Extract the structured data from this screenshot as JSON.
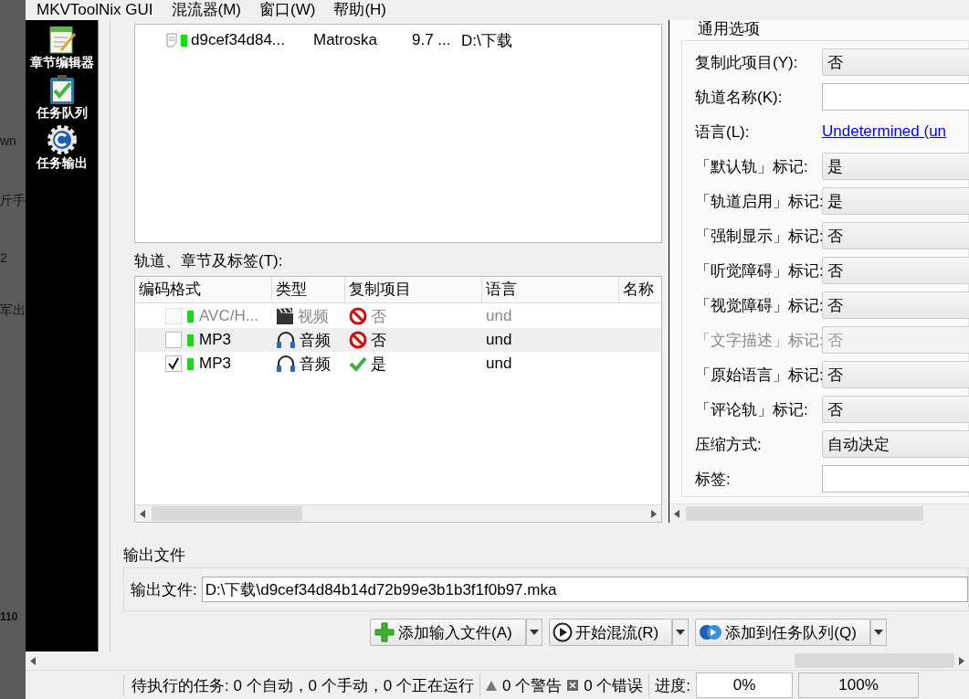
{
  "background_window": {
    "texts": [
      "wn",
      "斤手",
      "2",
      "军出",
      "110"
    ]
  },
  "menu_bar": {
    "title": "MKVToolNix GUI",
    "items": [
      {
        "label": "混流器(M)"
      },
      {
        "label": "窗口(W)"
      },
      {
        "label": "帮助(H)"
      }
    ]
  },
  "sidebar": {
    "items": [
      {
        "label": "章节编辑器",
        "kind": "notepad"
      },
      {
        "label": "任务队列",
        "kind": "clipboard"
      },
      {
        "label": "任务输出",
        "kind": "gear"
      }
    ]
  },
  "source_files": {
    "rows": [
      {
        "name": "d9cef34d84...",
        "format": "Matroska",
        "size": "9.7 ...",
        "path": "D:\\下载"
      }
    ]
  },
  "tracks": {
    "label": "轨道、章节及标签(T):",
    "columns": [
      "编码格式",
      "类型",
      "复制项目",
      "语言",
      "名称"
    ],
    "rows": [
      {
        "checked": false,
        "disabled": true,
        "codec": "AVC/H...",
        "kind": "video",
        "type": "视频",
        "copy": false,
        "copy_label": "否",
        "language": "und"
      },
      {
        "checked": false,
        "disabled": false,
        "codec": "MP3",
        "kind": "audio",
        "type": "音频",
        "copy": false,
        "copy_label": "否",
        "language": "und"
      },
      {
        "checked": true,
        "disabled": false,
        "codec": "MP3",
        "kind": "audio",
        "type": "音频",
        "copy": true,
        "copy_label": "是",
        "language": "und"
      }
    ]
  },
  "properties": {
    "section": "通用选项",
    "fields": [
      {
        "label": "复制此项目(Y):",
        "kind": "select",
        "value": "否",
        "disabled": false
      },
      {
        "label": "轨道名称(K):",
        "kind": "input",
        "disabled": false
      },
      {
        "label": "语言(L):",
        "kind": "link",
        "value": "Undetermined (un",
        "disabled": false
      },
      {
        "label": "「默认轨」标记:",
        "kind": "select",
        "value": "是",
        "disabled": false
      },
      {
        "label": "「轨道启用」标记:",
        "kind": "select",
        "value": "是",
        "disabled": false
      },
      {
        "label": "「强制显示」标记:",
        "kind": "select",
        "value": "否",
        "disabled": false
      },
      {
        "label": "「听觉障碍」标记:",
        "kind": "select",
        "value": "否",
        "disabled": false
      },
      {
        "label": "「视觉障碍」标记:",
        "kind": "select",
        "value": "否",
        "disabled": false
      },
      {
        "label": "「文字描述」标记:",
        "kind": "select",
        "value": "否",
        "disabled": true
      },
      {
        "label": "「原始语言」标记:",
        "kind": "select",
        "value": "否",
        "disabled": false
      },
      {
        "label": "「评论轨」标记:",
        "kind": "select",
        "value": "否",
        "disabled": false
      },
      {
        "label": "压缩方式:",
        "kind": "select",
        "value": "自动决定",
        "disabled": false
      },
      {
        "label": "标签:",
        "kind": "input",
        "disabled": false
      }
    ]
  },
  "output": {
    "group": "输出文件",
    "label": "输出文件:",
    "value": "D:\\下载\\d9cef34d84b14d72b99e3b1b3f1f0b97.mka"
  },
  "actions": [
    {
      "label": "添加输入文件(A)",
      "kind": "add"
    },
    {
      "label": "开始混流(R)",
      "kind": "play"
    },
    {
      "label": "添加到任务队列(Q)",
      "kind": "queue"
    }
  ],
  "status_bar": {
    "jobs": "待执行的任务: 0 个自动，0 个手动，0 个正在运行",
    "warnings": "0 个警告",
    "errors": "0 个错误",
    "progress_label": "进度:",
    "progress": "0%",
    "total": "100%"
  }
}
